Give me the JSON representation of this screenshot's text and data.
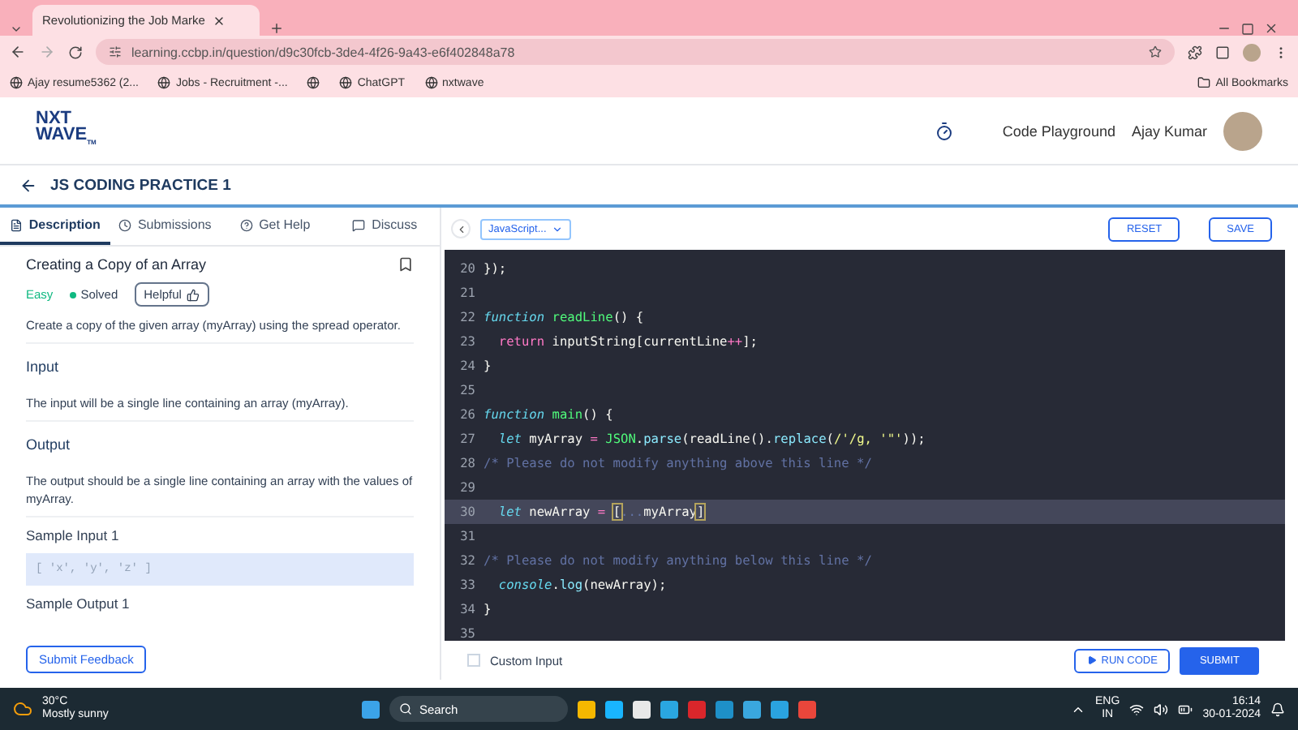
{
  "browser": {
    "tabs": [
      {
        "title": "Revolutionizing the Job Marke",
        "selected": true
      }
    ],
    "url": "learning.ccbp.in/question/d9c30fcb-3de4-4f26-9a43-e6f402848a78",
    "bookmarks": [
      {
        "kind": "link",
        "label": "Ajay resume5362 (2..."
      },
      {
        "kind": "link",
        "label": "Jobs - Recruitment -..."
      },
      {
        "kind": "icon"
      },
      {
        "kind": "link",
        "label": "ChatGPT"
      },
      {
        "kind": "link",
        "label": "nxtwave"
      }
    ],
    "all_bookmarks": "All Bookmarks"
  },
  "header": {
    "logo_top": "NXT",
    "logo_bottom": "WAVE",
    "logo_tm": "TM",
    "playground": "Code Playground",
    "user": "Ajay Kumar"
  },
  "page_title": "JS CODING PRACTICE 1",
  "panel_tabs": [
    {
      "label": "Description",
      "selected": true
    },
    {
      "label": "Submissions",
      "selected": false
    },
    {
      "label": "Get Help",
      "selected": false
    },
    {
      "label": "Discuss",
      "selected": false
    }
  ],
  "problem": {
    "title": "Creating a Copy of an Array",
    "difficulty": "Easy",
    "status": "Solved",
    "helpful": "Helpful",
    "description": "Create a copy of the given array (myArray) using the spread operator.",
    "sections": [
      {
        "heading": "Input",
        "text": "The input will be a single line containing an array (myArray)."
      },
      {
        "heading": "Output",
        "text": "The output should be a single line containing an array with the values of myArray."
      }
    ],
    "sample_input_label": "Sample Input 1",
    "sample_input": "[ 'x', 'y', 'z' ]",
    "sample_output_label": "Sample Output 1"
  },
  "submit_feedback": "Submit Feedback",
  "editor": {
    "language": "JavaScript...",
    "reset": "RESET",
    "save": "SAVE",
    "lines": [
      {
        "number": "20",
        "active": false,
        "tokens": [
          {
            "kind": "plain",
            "text": "});"
          }
        ]
      },
      {
        "number": "21",
        "active": false
      },
      {
        "number": "22",
        "active": false,
        "tokens": [
          {
            "kind": "keyword",
            "text": "function "
          },
          {
            "kind": "fn",
            "text": "readLine"
          },
          {
            "kind": "plain",
            "text": "() {"
          }
        ]
      },
      {
        "number": "23",
        "active": false,
        "tokens": [
          {
            "kind": "control",
            "text": "  return "
          },
          {
            "kind": "plain",
            "text": "inputString[currentLine"
          },
          {
            "kind": "control",
            "text": "++"
          },
          {
            "kind": "plain",
            "text": "];"
          }
        ]
      },
      {
        "number": "24",
        "active": false,
        "tokens": [
          {
            "kind": "plain",
            "text": "}"
          }
        ]
      },
      {
        "number": "25",
        "active": false
      },
      {
        "number": "26",
        "active": false,
        "tokens": [
          {
            "kind": "keyword",
            "text": "function "
          },
          {
            "kind": "fn",
            "text": "main"
          },
          {
            "kind": "plain",
            "text": "() {"
          }
        ]
      },
      {
        "number": "27",
        "active": false,
        "tokens": [
          {
            "kind": "keyword",
            "text": "  let "
          },
          {
            "kind": "plain",
            "text": "myArray "
          },
          {
            "kind": "control",
            "text": "= "
          },
          {
            "kind": "fn",
            "text": "JSON"
          },
          {
            "kind": "plain",
            "text": "."
          },
          {
            "kind": "method",
            "text": "parse"
          },
          {
            "kind": "plain",
            "text": "(readLine()."
          },
          {
            "kind": "method",
            "text": "replace"
          },
          {
            "kind": "plain",
            "text": "("
          },
          {
            "kind": "string",
            "text": "/'/g, '\"'"
          },
          {
            "kind": "plain",
            "text": "));"
          }
        ]
      },
      {
        "number": "28",
        "active": false,
        "tokens": [
          {
            "kind": "comment",
            "text": "/* Please do not modify anything above this line */"
          }
        ]
      },
      {
        "number": "29",
        "active": false
      },
      {
        "number": "30",
        "active": true,
        "tokens": [
          {
            "kind": "keyword",
            "text": "  let "
          },
          {
            "kind": "plain",
            "text": "newArray "
          },
          {
            "kind": "control",
            "text": "= "
          },
          {
            "kind": "bracket",
            "text": "["
          },
          {
            "kind": "comment",
            "text": "..."
          },
          {
            "kind": "plain",
            "text": "myArray"
          },
          {
            "kind": "bracket",
            "text": "]"
          }
        ]
      },
      {
        "number": "31",
        "active": false
      },
      {
        "number": "32",
        "active": false,
        "tokens": [
          {
            "kind": "comment",
            "text": "/* Please do not modify anything below this line */"
          }
        ]
      },
      {
        "number": "33",
        "active": false,
        "tokens": [
          {
            "kind": "keyword",
            "text": "  console"
          },
          {
            "kind": "plain",
            "text": "."
          },
          {
            "kind": "method",
            "text": "log"
          },
          {
            "kind": "plain",
            "text": "(newArray);"
          }
        ]
      },
      {
        "number": "34",
        "active": false,
        "tokens": [
          {
            "kind": "plain",
            "text": "}"
          }
        ]
      },
      {
        "number": "35",
        "active": false
      }
    ],
    "custom_input": {
      "label": "Custom Input",
      "checked": false
    },
    "run": "RUN CODE",
    "submit": "SUBMIT"
  },
  "taskbar": {
    "temperature": "30°C",
    "weather": "Mostly sunny",
    "search": "Search",
    "language": "ENG",
    "region": "IN",
    "time": "16:14",
    "date": "30-01-2024"
  }
}
